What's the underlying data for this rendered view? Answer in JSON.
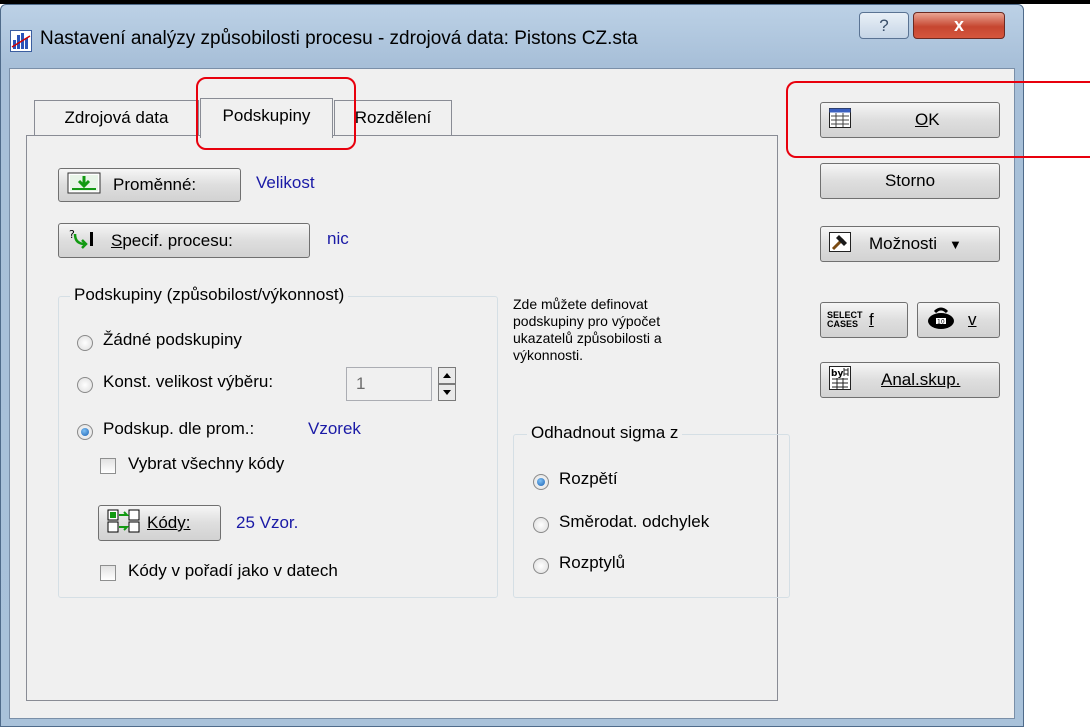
{
  "window": {
    "title": "Nastavení analýzy způsobilosti procesu - zdrojová data: Pistons CZ.sta",
    "help_symbol": "?",
    "close_symbol": "x"
  },
  "tabs": [
    {
      "label": "Zdrojová data"
    },
    {
      "label": "Podskupiny"
    },
    {
      "label": "Rozdělení"
    }
  ],
  "variables": {
    "button_label": "Proměnné:",
    "value": "Velikost"
  },
  "process": {
    "button_label": "Specif. procesu:",
    "value": "nic"
  },
  "subgroups": {
    "legend": "Podskupiny (způsobilost/výkonnost)",
    "opt_none": "Žádné podskupiny",
    "opt_const": "Konst. velikost výběru:",
    "const_value": "1",
    "opt_by_var": "Podskup. dle prom.:",
    "by_var_value": "Vzorek",
    "select_all_codes": "Vybrat všechny kódy",
    "codes_button": "Kódy:",
    "codes_value": "25 Vzor.",
    "codes_order": "Kódy v pořadí jako v datech"
  },
  "help_text": [
    "Zde můžete definovat",
    "podskupiny pro výpočet",
    "ukazatelů způsobilosti a",
    "výkonnosti."
  ],
  "sigma": {
    "legend": "Odhadnout sigma z",
    "opt_range": "Rozpětí",
    "opt_std": "Směrodat. odchylek",
    "opt_var": "Rozptylů"
  },
  "side": {
    "ok": "OK",
    "cancel": "Storno",
    "options": "Možnosti",
    "select_cases_icon": "SELECT CASES",
    "f": "f",
    "v": "v",
    "by_group": "Anal.skup."
  },
  "colors": {
    "value_text": "#1a1aa6",
    "highlight": "#e8000d"
  }
}
